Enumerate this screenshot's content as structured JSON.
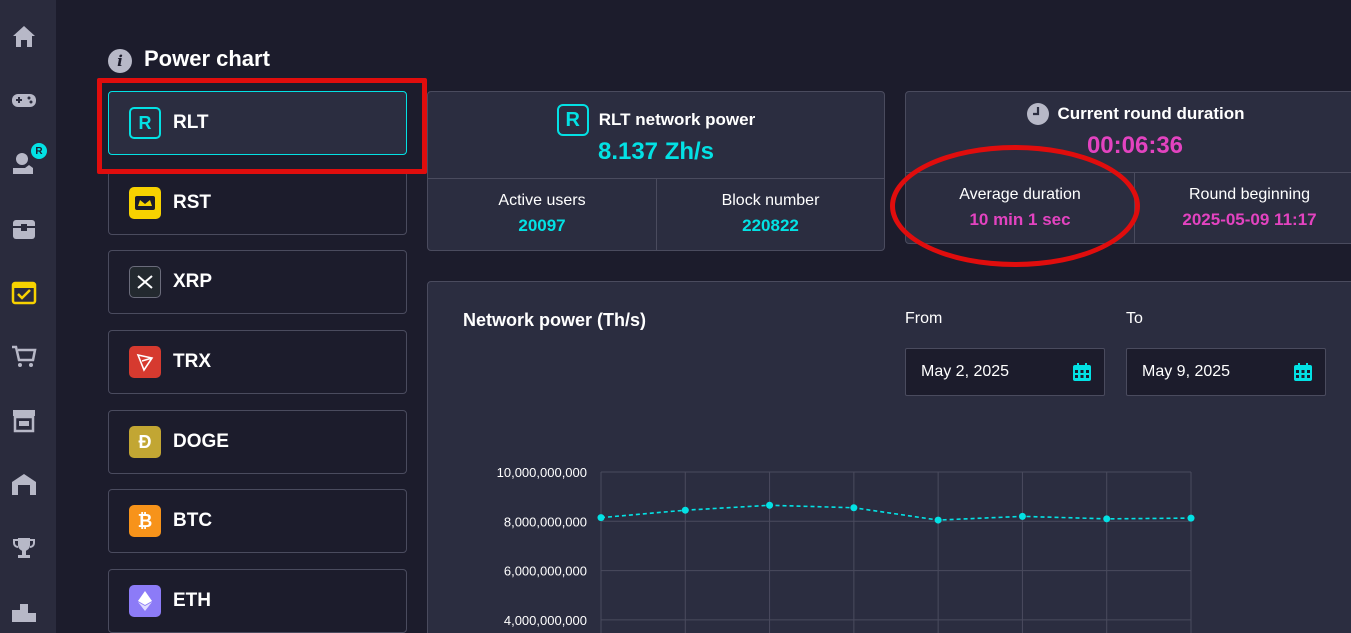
{
  "page": {
    "title": "Power chart"
  },
  "currencies": [
    {
      "label": "RLT",
      "icon": "rlt-icon",
      "color": "#03e1e4"
    },
    {
      "label": "RST",
      "icon": "rst-icon",
      "color": "#f7d200"
    },
    {
      "label": "XRP",
      "icon": "xrp-icon",
      "color": "#23292f"
    },
    {
      "label": "TRX",
      "icon": "trx-icon",
      "color": "#d63a2f"
    },
    {
      "label": "DOGE",
      "icon": "doge-icon",
      "color": "#c2a633"
    },
    {
      "label": "BTC",
      "icon": "btc-icon",
      "color": "#f7931a"
    },
    {
      "label": "ETH",
      "icon": "eth-icon",
      "color": "#8c7bf7"
    }
  ],
  "network": {
    "title": "RLT network power",
    "value": "8.137 Zh/s",
    "active_users_label": "Active users",
    "active_users": "20097",
    "block_number_label": "Block number",
    "block_number": "220822"
  },
  "round": {
    "title": "Current round duration",
    "timer": "00:06:36",
    "avg_label": "Average duration",
    "avg_value": "10 min 1 sec",
    "begin_label": "Round beginning",
    "begin_value": "2025-05-09 11:17"
  },
  "filters": {
    "from_label": "From",
    "from_value": "May 2, 2025",
    "to_label": "To",
    "to_value": "May 9, 2025"
  },
  "colors": {
    "accent_cyan": "#03e1e4",
    "accent_pink": "#e343c0",
    "highlight_red": "#e00d0d"
  },
  "chart_data": {
    "type": "line",
    "title": "Network power (Th/s)",
    "x": [
      1,
      2,
      3,
      4,
      5,
      6,
      7,
      8
    ],
    "series": [
      {
        "values": [
          8150000000,
          8450000000,
          8650000000,
          8550000000,
          8050000000,
          8200000000,
          8100000000,
          8130000000
        ]
      }
    ],
    "yticks": [
      "10,000,000,000",
      "8,000,000,000",
      "6,000,000,000",
      "4,000,000,000"
    ],
    "ytick_values": [
      10000000000,
      8000000000,
      6000000000,
      4000000000
    ],
    "ylim_visible": [
      4000000000,
      10000000000
    ],
    "grid": true,
    "line_style": "dashed"
  }
}
